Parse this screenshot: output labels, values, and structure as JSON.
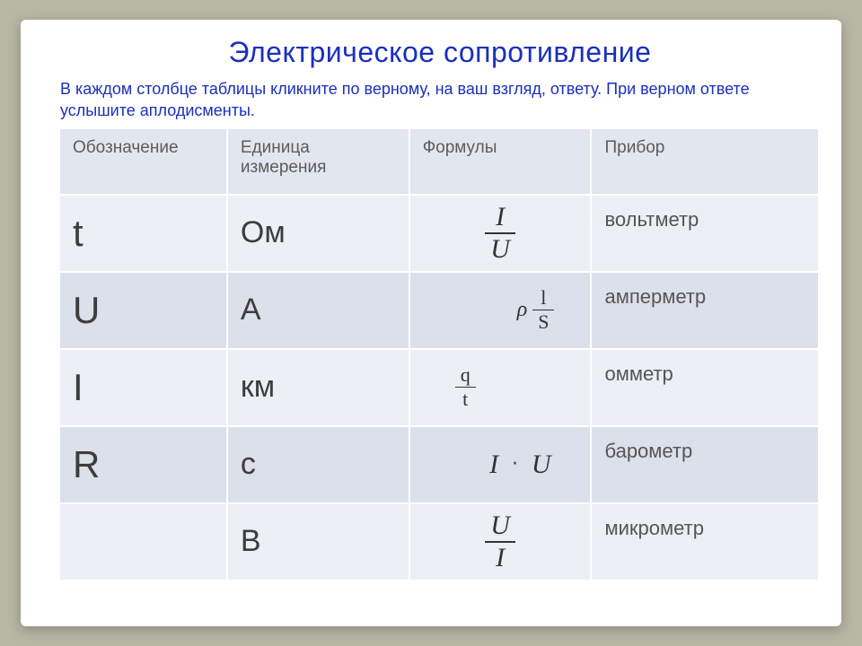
{
  "title": "Электрическое сопротивление",
  "instructions": "В каждом столбце таблицы кликните по верному, на ваш взгляд, ответу. При верном ответе услышите аплодисменты.",
  "headers": {
    "symbol": "Обозначение",
    "unit": "Единица измерения",
    "formula": "Формулы",
    "device": "Прибор"
  },
  "rows": [
    {
      "symbol": "t",
      "unit": "Ом",
      "formula": {
        "type": "frac",
        "num": "I",
        "den": "U",
        "size": "big"
      },
      "device": "вольтметр"
    },
    {
      "symbol": "U",
      "unit": "А",
      "formula": {
        "type": "rho_ls",
        "rho": "ρ",
        "num": "l",
        "den": "S"
      },
      "device": "амперметр"
    },
    {
      "symbol": "I",
      "unit": "км",
      "formula": {
        "type": "frac",
        "num": "q",
        "den": "t",
        "size": "sm"
      },
      "device": "омметр"
    },
    {
      "symbol": "R",
      "unit": "с",
      "formula": {
        "type": "product",
        "a": "I",
        "b": "U"
      },
      "device": "барометр"
    },
    {
      "symbol": "",
      "unit": "В",
      "formula": {
        "type": "frac",
        "num": "U",
        "den": "I",
        "size": "big"
      },
      "device": "микрометр"
    }
  ]
}
